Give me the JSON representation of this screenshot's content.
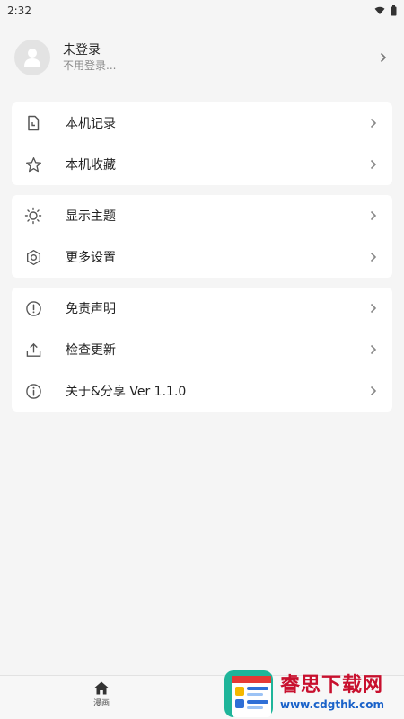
{
  "status": {
    "time": "2:32"
  },
  "profile": {
    "name": "未登录",
    "subtitle": "不用登录..."
  },
  "groups": [
    {
      "items": [
        {
          "label": "本机记录",
          "icon": "file-history-icon"
        },
        {
          "label": "本机收藏",
          "icon": "star-icon"
        }
      ]
    },
    {
      "items": [
        {
          "label": "显示主题",
          "icon": "sun-icon"
        },
        {
          "label": "更多设置",
          "icon": "hexagon-settings-icon"
        }
      ]
    },
    {
      "items": [
        {
          "label": "免责声明",
          "icon": "alert-circle-icon"
        },
        {
          "label": "检查更新",
          "icon": "upload-icon"
        },
        {
          "label": "关于&分享 Ver 1.1.0",
          "icon": "info-icon"
        }
      ]
    }
  ],
  "bottom_nav": {
    "items": [
      {
        "label": "漫画",
        "icon": "home-icon"
      }
    ]
  },
  "watermark": {
    "title": "睿思下载网",
    "url": "www.cdgthk.com"
  },
  "colors": {
    "background": "#f5f5f5",
    "card": "#ffffff",
    "text": "#222222",
    "muted": "#888888",
    "icon": "#555555"
  }
}
